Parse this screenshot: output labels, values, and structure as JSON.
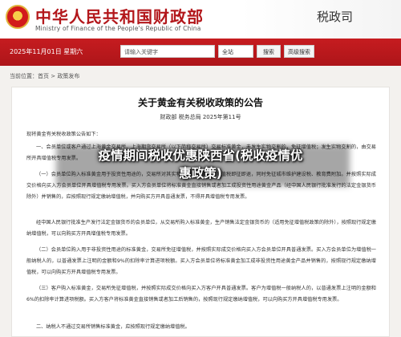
{
  "header": {
    "title_cn": "中华人民共和国财政部",
    "title_en": "Ministry of Finance of the People's Republic of China",
    "dept": "税政司"
  },
  "topbar": {
    "date": "2025年11月01日 星期六",
    "search_placeholder": "请输入关键字",
    "search_scope": "全站",
    "search_button": "搜索",
    "advanced_button": "高级搜索"
  },
  "breadcrumb": {
    "prefix": "当前位置：",
    "home": "首页",
    "sep1": " > ",
    "section": "政策发布"
  },
  "document": {
    "title": "关于黄金有关税收政策的公告",
    "issuer": "财政部  税务总局  2025年第11号",
    "paragraphs": [
      "现将黄金有关税收政策公告如下：",
      "一、会员单位或客户通过上海黄金交易所、上海期货交易所（以下简称交易所）交易标准黄金，未发生实物交割的，免征增值税；发生实物交割的，由交易所开具增值税专用发票。",
      "（一）会员单位购入标准黄金用于投资性用途的，交易所对其实物交割的标准黄金增值税即征即退，同时免征城市维护建设税、教育费附加。并按照实际成交价格向买入方会员单位开具增值税专用发票。买入方会员单位将标准黄金直接销售或者加工成投资性用途黄金产品（经中国人民银行批准发行的法定金银货币除外）并销售的，应按照现行规定缴纳增值税，并向购买方开具普通发票，不得开具增值税专用发票。",
      "经中国人民银行批准生产发行法定金银货币的会员单位，从交易所购入标准黄金，生产销售法定金银货币的（适用免征增值税政策的除外），按照现行规定缴纳增值税，可以向购买方开具增值税专用发票。",
      "（二）会员单位购入用于非投资性用途的标准黄金，交易所免征增值税，并按照实际成交价格向买入方会员单位开具普通发票。买入方会员单位为增值税一般纳税人的，以普通发票上注明的金额和9%的扣除率计算进项税额。买入方会员单位将标准黄金加工成非投资性用途黄金产品并销售的，按照现行规定缴纳增值税，可以向购买方开具增值税专用发票。",
      "（三）客户购入标准黄金，交易所免征增值税，并按照实际成交价格向买入方客户开具普通发票。客户为增值税一般纳税人的，以普通发票上注明的金额和6%的扣除率计算进项税额。买入方客户将标准黄金直接销售或者加工后销售的，按照现行规定缴纳增值税，可以向购买方开具增值税专用发票。",
      "二、纳税人不通过交易所销售标准黄金，应按照现行规定缴纳增值税。"
    ]
  },
  "overlay": {
    "line1": "疫情期间税收优惠陕西省(税收疫情优",
    "line2": "惠政策)"
  },
  "colors": {
    "brand_red": "#b3171b",
    "bar_red": "#c61c20"
  }
}
